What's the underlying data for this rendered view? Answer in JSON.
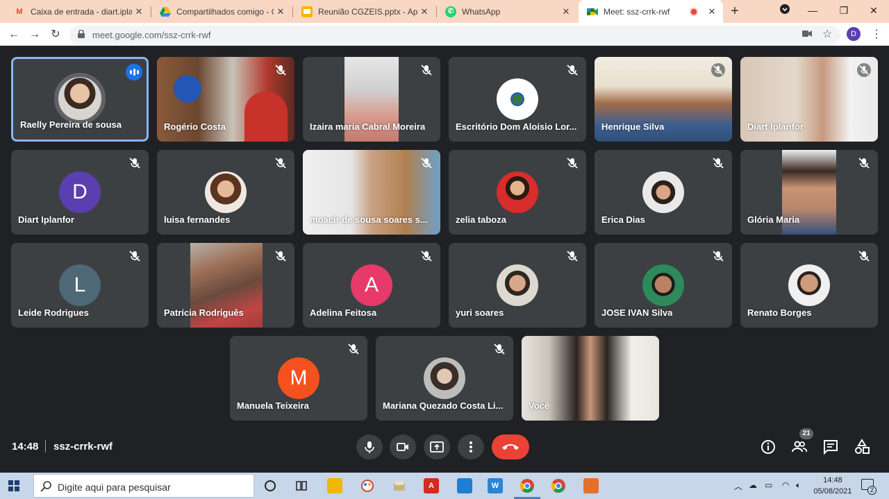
{
  "browser": {
    "tabs": [
      {
        "title": "Caixa de entrada - diart.iplanfor",
        "icon": "gmail-icon",
        "active": false
      },
      {
        "title": "Compartilhados comigo - Google Drive",
        "icon": "drive-icon",
        "active": false
      },
      {
        "title": "Reunião CGZEIS.pptx - Apresentações",
        "icon": "slides-icon",
        "active": false
      },
      {
        "title": "WhatsApp",
        "icon": "whatsapp-icon",
        "active": false
      },
      {
        "title": "Meet: ssz-crrk-rwf",
        "icon": "meet-icon",
        "active": true
      }
    ],
    "url": "meet.google.com/ssz-crrk-rwf",
    "profile_initial": "D"
  },
  "meet": {
    "participants": [
      {
        "name": "Raelly Pereira de sousa",
        "type": "photo",
        "speaking": true
      },
      {
        "name": "Rogério Costa",
        "type": "video",
        "muted": true
      },
      {
        "name": "Izaira maria Cabral Moreira",
        "type": "video",
        "muted": true
      },
      {
        "name": "Escritório Dom Aloísio Lor...",
        "type": "logo",
        "muted": true
      },
      {
        "name": "Henrique Silva",
        "type": "video",
        "muted": true
      },
      {
        "name": "Diart Iplanfor",
        "type": "video",
        "muted": true
      },
      {
        "name": "Diart Iplanfor",
        "type": "letter",
        "initial": "D",
        "color": "#5b3fb1",
        "muted": true
      },
      {
        "name": "luisa fernandes",
        "type": "photo",
        "muted": true
      },
      {
        "name": "moacir de sousa soares s...",
        "type": "video",
        "muted": true
      },
      {
        "name": "zelia taboza",
        "type": "photo",
        "muted": true
      },
      {
        "name": "Erica Dias",
        "type": "photo",
        "muted": true
      },
      {
        "name": "Glória Maria",
        "type": "video",
        "muted": true
      },
      {
        "name": "Leide Rodrigues",
        "type": "letter",
        "initial": "L",
        "color": "#4e6876",
        "muted": true
      },
      {
        "name": "Patrícia Rodriguês",
        "type": "video",
        "muted": true
      },
      {
        "name": "Adelina Feitosa",
        "type": "letter",
        "initial": "A",
        "color": "#e8396b",
        "muted": true
      },
      {
        "name": "yuri soares",
        "type": "photo",
        "muted": true
      },
      {
        "name": "JOSE IVAN Silva",
        "type": "photo",
        "muted": true
      },
      {
        "name": "Renato Borges",
        "type": "photo",
        "muted": true
      },
      {
        "name": "Manuela Teixeira",
        "type": "letter",
        "initial": "M",
        "color": "#f4511e",
        "muted": true
      },
      {
        "name": "Mariana Quezado Costa Li...",
        "type": "photo",
        "muted": true
      },
      {
        "name": "Você",
        "type": "video",
        "muted": false
      }
    ],
    "time": "14:48",
    "meeting_code": "ssz-crrk-rwf",
    "participant_count": "21",
    "colors": {
      "background": "#202124",
      "tile": "#3c4043",
      "hangup": "#ea4335",
      "speaking": "#8ab4f8"
    }
  },
  "taskbar": {
    "search_placeholder": "Digite aqui para pesquisar",
    "clock_time": "14:48",
    "clock_date": "05/08/2021",
    "notifications": "2"
  }
}
